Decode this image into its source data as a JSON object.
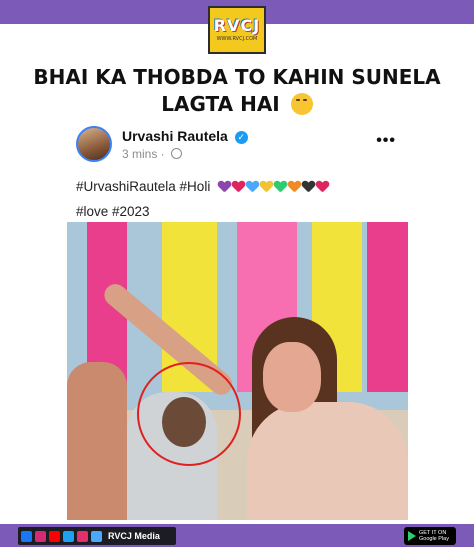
{
  "brand": {
    "logo_text": "RVCJ",
    "logo_sub": "WWW.RVCJ.COM"
  },
  "headline": "BHAI KA THOBDA TO KAHIN SUNELA LAGTA HAI",
  "post": {
    "author": "Urvashi Rautela",
    "time": "3 mins ·",
    "caption_line1": "#UrvashiRautela #Holi",
    "caption_line2": "#love #2023",
    "heart_colors": [
      "#8e44ad",
      "#e0245e",
      "#4aa8ff",
      "#f2c230",
      "#2ecc71",
      "#f08a24",
      "#333333",
      "#e0245e"
    ]
  },
  "footer": {
    "social_label": "RVCJ Media",
    "store_line1": "GET IT ON",
    "store_line2": "Google Play"
  }
}
